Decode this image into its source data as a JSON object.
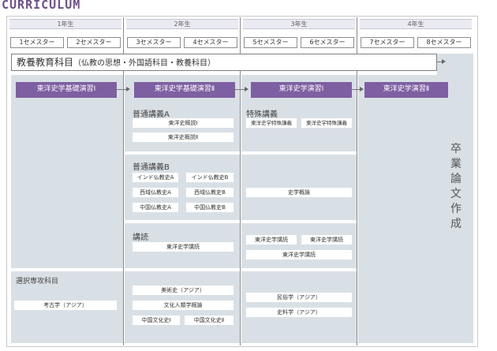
{
  "brand": "CURRICULUM",
  "years": [
    "1年生",
    "2年生",
    "3年生",
    "4年生"
  ],
  "semesters": [
    "1セメスター",
    "2セメスター",
    "3セメスター",
    "4セメスター",
    "5セメスター",
    "6セメスター",
    "7セメスター",
    "8セメスター"
  ],
  "education": {
    "title": "教養教育科目",
    "sub": "（仏教の思想・外国語科目・教養科目）"
  },
  "seminars": [
    "東洋史学基礎演習Ⅰ",
    "東洋史学基礎演習Ⅱ",
    "東洋史学演習Ⅰ",
    "東洋史学演習Ⅱ"
  ],
  "general_a": {
    "title": "普通講義A",
    "items": [
      "東洋史概説Ⅰ",
      "東洋史概説Ⅱ"
    ]
  },
  "special": {
    "title": "特殊講義",
    "items": [
      "東洋史学特殊講義",
      "東洋史学特殊講義"
    ]
  },
  "general_b": {
    "title": "普通講義B",
    "items": [
      "インド仏教史A",
      "インド仏教史B",
      "西域仏教史A",
      "西域仏教史B",
      "中国仏教史A",
      "中国仏教史B"
    ]
  },
  "shigaku": "史学概論",
  "reading": {
    "title": "講読",
    "item": "東洋史学講読",
    "y3": [
      "東洋史学講読",
      "東洋史学講読",
      "東洋史学講読"
    ]
  },
  "elective": {
    "title": "選択専攻科目",
    "y1": "考古学（アジア）",
    "y2": [
      "美術史（アジア）",
      "文化人類学概論",
      "中国文化史Ⅰ",
      "中国文化史Ⅱ"
    ],
    "y3": [
      "民俗学（アジア）",
      "史料学（アジア）"
    ]
  },
  "graduation": [
    "卒",
    "業",
    "論",
    "文",
    "作",
    "成"
  ]
}
